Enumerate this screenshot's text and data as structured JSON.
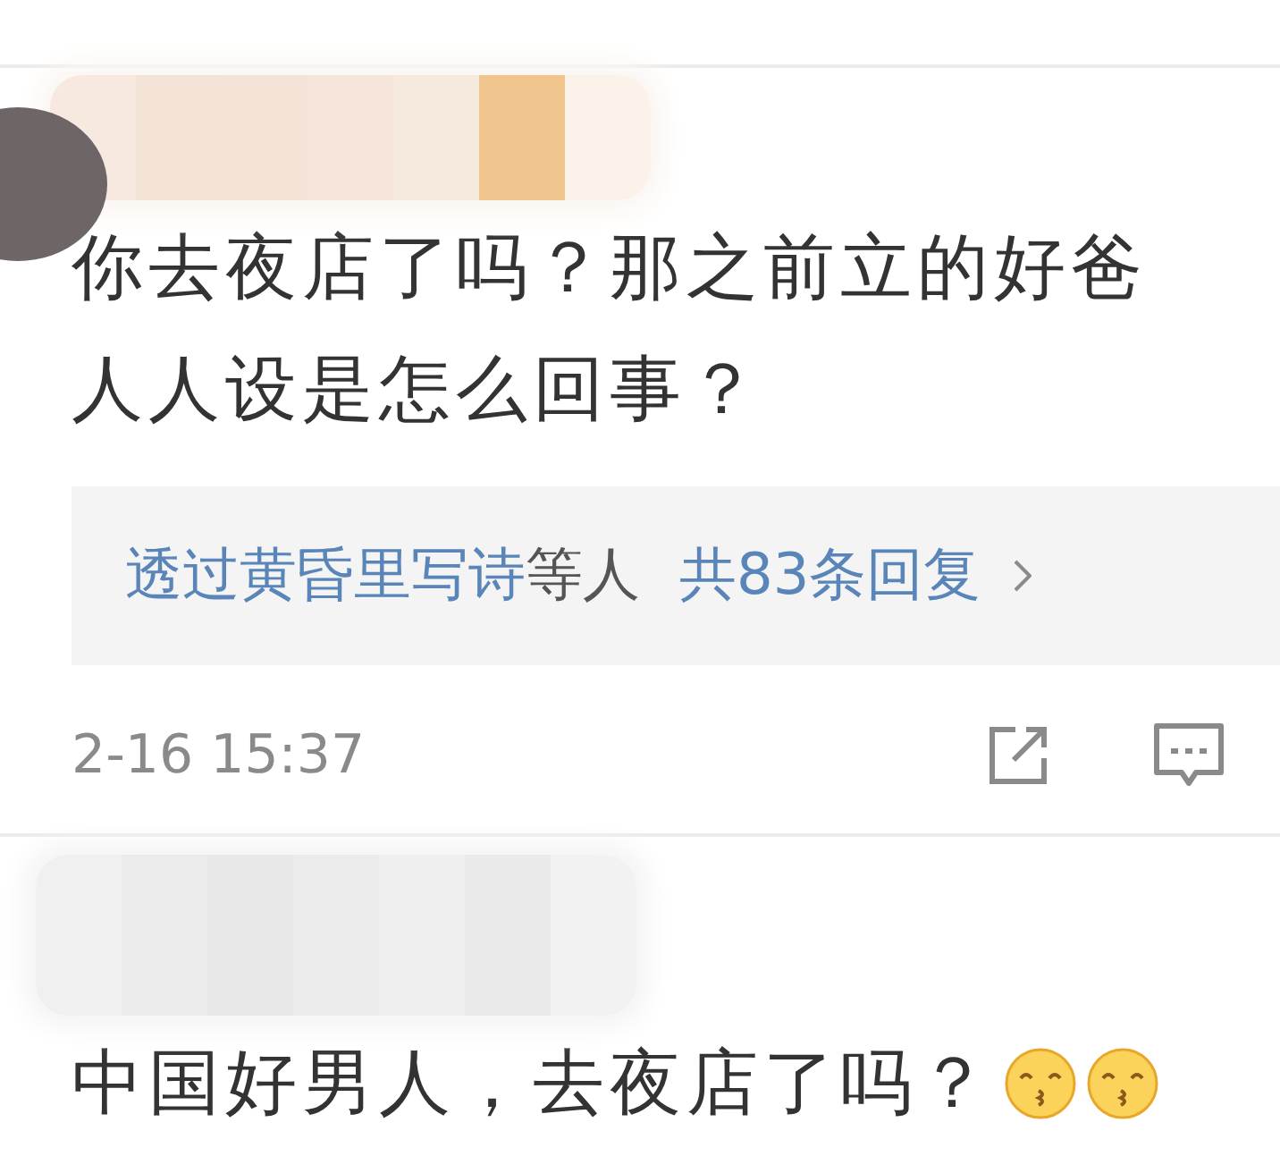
{
  "comments": [
    {
      "lines": [
        "你去夜店了吗？那之前立的好爸",
        "人人设是怎么回事？"
      ],
      "reply_summary": {
        "users": "透过黄昏里写诗",
        "suffix": "等人",
        "count": "共83条回复"
      },
      "time": "2-16 15:37"
    },
    {
      "text": "中国好男人，去夜店了吗？",
      "emojis": [
        {
          "kind": "kiss"
        },
        {
          "kind": "kiss"
        }
      ]
    }
  ]
}
